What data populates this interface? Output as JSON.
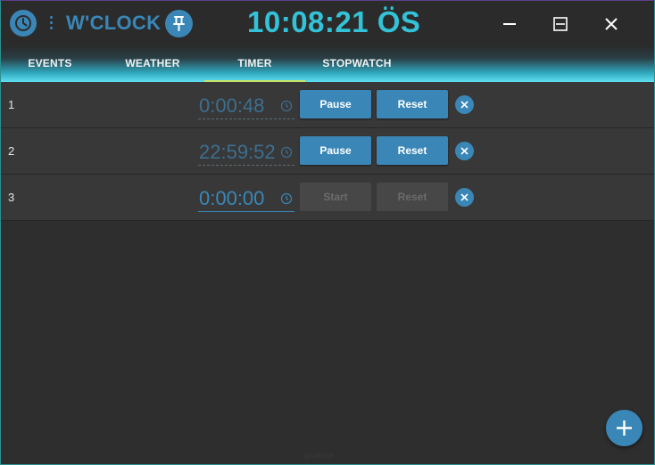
{
  "titlebar": {
    "app_icon": "clock-icon",
    "menu_icon": "kebab-menu-icon",
    "app_name": "W'CLOCK",
    "pin_icon": "pin-icon",
    "clock": "10:08:21 ÖS",
    "minimize_icon": "minimize-icon",
    "maximize_icon": "restore-icon",
    "close_icon": "close-icon"
  },
  "tabs": [
    {
      "label": "EVENTS",
      "active": false
    },
    {
      "label": "WEATHER",
      "active": false
    },
    {
      "label": "TIMER",
      "active": true
    },
    {
      "label": "STOPWATCH",
      "active": false
    }
  ],
  "timers": [
    {
      "index": "1",
      "time": "0:00:48",
      "primary_label": "Pause",
      "reset_label": "Reset",
      "running": true
    },
    {
      "index": "2",
      "time": "22:59:52",
      "primary_label": "Pause",
      "reset_label": "Reset",
      "running": true
    },
    {
      "index": "3",
      "time": "0:00:00",
      "primary_label": "Start",
      "reset_label": "Reset",
      "running": false
    }
  ],
  "fab_icon": "plus-icon",
  "footer": "grodbase",
  "colors": {
    "accent": "#3a87b7",
    "clock": "#33c3d8",
    "background": "#2e2e2e",
    "row": "#383838",
    "tab_indicator": "#c8e36a"
  }
}
